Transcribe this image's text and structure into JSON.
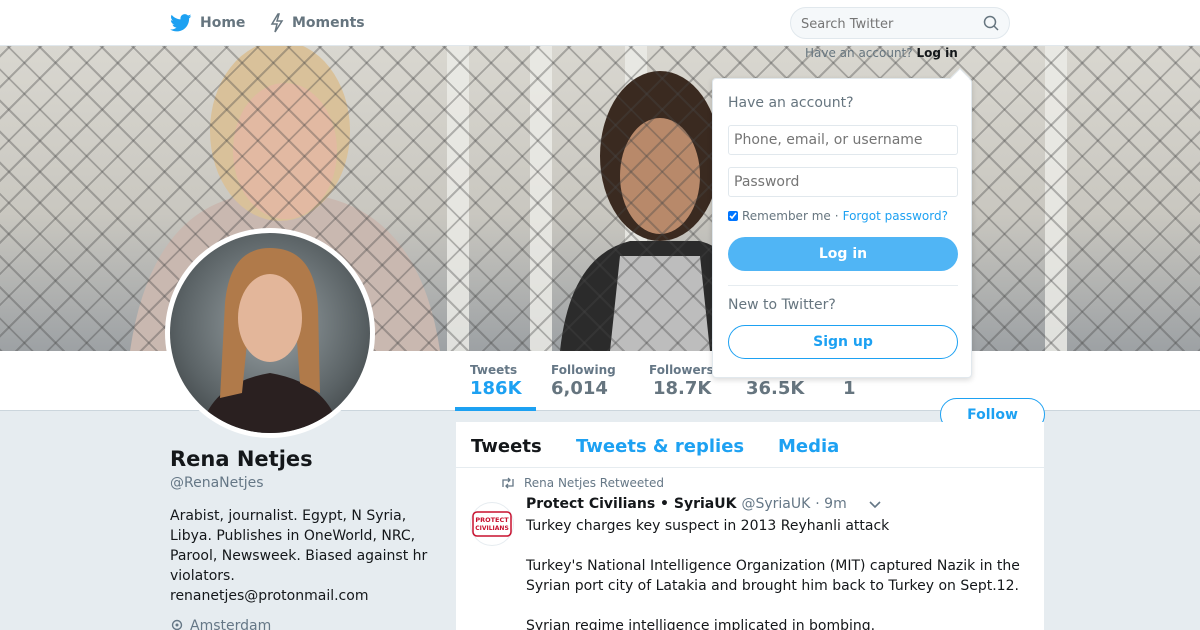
{
  "nav": {
    "home_label": "Home",
    "moments_label": "Moments",
    "search_placeholder": "Search Twitter",
    "login_prompt": "Have an account?",
    "login_link": "Log in"
  },
  "colors": {
    "accent": "#1da1f2",
    "login_button": "#50b5f5",
    "text_secondary": "#657786"
  },
  "icons": {
    "home": "twitter-bird-icon",
    "moments": "lightning-icon",
    "search": "search-icon",
    "retweet": "retweet-icon",
    "location": "location-pin-icon",
    "caret": "chevron-down-icon"
  },
  "profile": {
    "name": "Rena Netjes",
    "handle": "@RenaNetjes",
    "bio": "Arabist, journalist. Egypt, N Syria, Libya. Publishes in OneWorld, NRC, Parool, Newsweek. Biased against hr violators.",
    "email": "renanetjes@protonmail.com",
    "location": "Amsterdam",
    "follow_label": "Follow"
  },
  "stats": [
    {
      "label": "Tweets",
      "value": "186K"
    },
    {
      "label": "Following",
      "value": "6,014"
    },
    {
      "label": "Followers",
      "value": "18.7K"
    },
    {
      "label": "",
      "value": "36.5K"
    },
    {
      "label": "",
      "value": "1"
    }
  ],
  "timeline": {
    "tabs": [
      "Tweets",
      "Tweets & replies",
      "Media"
    ],
    "retweet_note": "Rena Netjes Retweeted",
    "tweet": {
      "author": "Protect Civilians • SyriaUK",
      "handle": "@SyriaUK",
      "time": "· 9m",
      "avatar_text_1": "PROTECT",
      "avatar_text_2": "CIVILIANS",
      "lines": [
        "Turkey charges key suspect in 2013 Reyhanli attack",
        "Turkey's National Intelligence Organization (MIT) captured Nazik in the Syrian port city of Latakia and brought him back to Turkey on Sept.12.",
        "Syrian regime intelligence implicated in bombing."
      ]
    }
  },
  "login": {
    "title": "Have an account?",
    "username_placeholder": "Phone, email, or username",
    "password_placeholder": "Password",
    "remember": "Remember me",
    "separator": "·",
    "forgot": "Forgot password?",
    "login_button": "Log in",
    "new_prompt": "New to Twitter?",
    "signup_button": "Sign up"
  }
}
